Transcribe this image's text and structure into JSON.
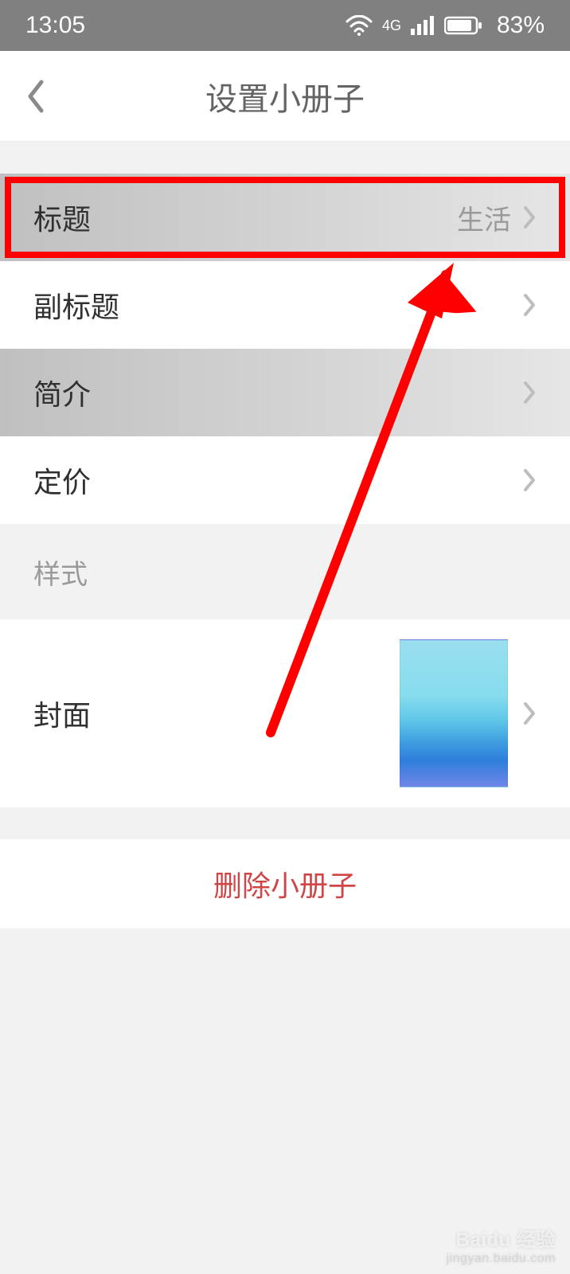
{
  "status": {
    "time": "13:05",
    "network_type": "4G",
    "battery_pct": "83%"
  },
  "nav": {
    "title": "设置小册子"
  },
  "rows": {
    "title": {
      "label": "标题",
      "value": "生活"
    },
    "subtitle": {
      "label": "副标题"
    },
    "intro": {
      "label": "简介"
    },
    "price": {
      "label": "定价"
    }
  },
  "sections": {
    "style": "样式"
  },
  "cover": {
    "label": "封面"
  },
  "danger": {
    "delete": "删除小册子"
  },
  "watermark": {
    "line1": "Baidu 经验",
    "line2": "jingyan.baidu.com"
  },
  "annotation": {
    "highlight_target": "title-row"
  }
}
